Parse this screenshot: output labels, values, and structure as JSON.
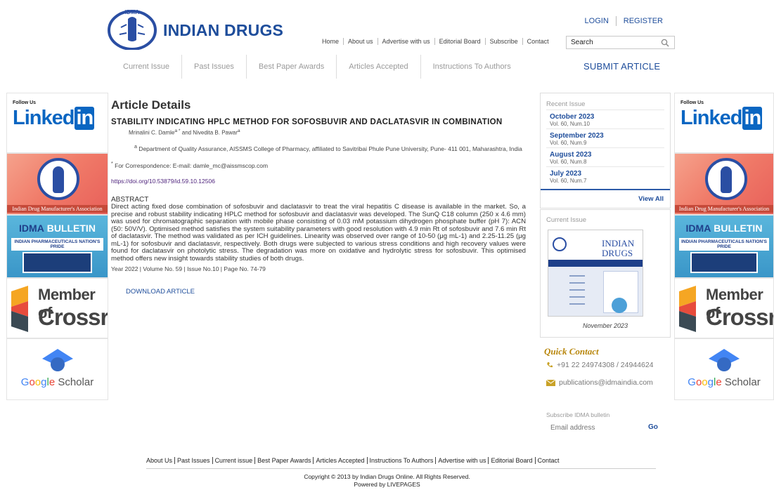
{
  "brand": {
    "name": "INDIAN DRUGS",
    "emblem_text": "IDMA"
  },
  "auth": {
    "login": "LOGIN",
    "register": "REGISTER"
  },
  "topnav": [
    "Home",
    "About us",
    "Advertise with us",
    "Editorial Board",
    "Subscribe",
    "Contact"
  ],
  "search": {
    "value": "Search"
  },
  "mainnav": [
    "Current Issue",
    "Past Issues",
    "Best Paper Awards",
    "Articles Accepted",
    "Instructions To Authors"
  ],
  "submit_label": "SUBMIT ARTICLE",
  "side": {
    "follow": "Follow Us",
    "linkedin": "Linked",
    "linkedin_in": "in",
    "idma_caption": "Indian Drug Manufacturer's Association",
    "bulletin_a": "IDMA",
    "bulletin_b": "BULLETIN",
    "bulletin_band": "INDIAN PHARMACEUTICALS NATION'S PRIDE",
    "crossref_1": "Member of",
    "crossref_2": "Crossref",
    "scholar_g": "G",
    "scholar_o1": "o",
    "scholar_o2": "o",
    "scholar_g2": "g",
    "scholar_l": "l",
    "scholar_e": "e",
    "scholar_rest": " Scholar"
  },
  "article": {
    "heading": "Article Details",
    "title": "STABILITY INDICATING HPLC METHOD FOR SOFOSBUVIR AND DACLATASVIR IN COMBINATION",
    "authors": "Mrinalini C. Damle",
    "authors_sup": "a *",
    "authors_mid": " and Nivedita B. Pawar",
    "authors_sup2": "a",
    "affil_sup": "a",
    "affiliation": " Department of Quality Assurance, AISSMS College of Pharmacy, affiliated to Savitribai Phule Pune University, Pune- 411 001, Maharashtra, India",
    "corr_sup": "*",
    "correspondence": " For Correspondence: E-mail: damle_mc@aissmscop.com",
    "doi": "https://doi.org/10.53879/id.59.10.12506",
    "abstract_heading": "ABSTRACT",
    "abstract": "Direct acting fixed dose combination of sofosbuvir and daclatasvir to treat the viral hepatitis C disease is available in the market. So, a precise and robust stability indicating HPLC method for sofosbuvir and daclatasvir was developed. The SunQ C18 column (250 x 4.6 mm) was used for chromatographic separation with mobile phase consisting of 0.03 mM potassium dihydrogen phosphate buffer (pH 7): ACN (50: 50V/V). Optimised method satisfies the system suitability parameters with good resolution with 4.9 min Rt of sofosbuvir and 7.6 min Rt of daclatasvir. The method was validated as per ICH guidelines. Linearity was observed over range of 10-50 (μg mL-1) and 2.25-11.25 (μg mL-1) for sofosbuvir and daclatasvir, respectively. Both drugs were subjected to various stress conditions and high recovery values were found for daclatasvir on photolytic stress. The degradation was more on oxidative and hydrolytic stress for sofosbuvir. This optimised method offers new insight towards stability studies of both drugs.",
    "meta": "Year 2022 | Volume No. 59 | Issue No.10 | Page No. 74-79",
    "download": "DOWNLOAD ARTICLE"
  },
  "recent": {
    "heading": "Recent Issue",
    "items": [
      {
        "month": "October  2023",
        "vol": "Vol. 60, Num.10"
      },
      {
        "month": "September  2023",
        "vol": "Vol. 60, Num.9"
      },
      {
        "month": "August  2023",
        "vol": "Vol. 60, Num.8"
      },
      {
        "month": "July  2023",
        "vol": "Vol. 60, Num.7"
      }
    ],
    "view_all": "View All"
  },
  "current": {
    "heading": "Current Issue",
    "cover_title_1": "INDIAN",
    "cover_title_2": "DRUGS",
    "month": "November 2023"
  },
  "contact": {
    "heading": "Quick Contact",
    "phone": "+91 22 24974308 / 24944624",
    "email": "publications@idmaindia.com",
    "subscribe_label": "Subscribe IDMA bulletin",
    "email_placeholder": "Email address",
    "go": "Go"
  },
  "footer": {
    "links": [
      "About Us",
      "Past Issues",
      "Current issue",
      "Best Paper Awards",
      "Articles Accepted",
      "Instructions To Authors",
      "Advertise with us",
      "Editorial Board",
      "Contact"
    ],
    "copyright": "Copyright © 2013 by Indian Drugs Online. All Rights Reserved.",
    "powered": "Powered by LIVEPAGES"
  },
  "colors": {
    "brand_blue": "#1e4d9b",
    "contact_gold": "#b8860b",
    "doi_purple": "#4b1f7a"
  }
}
